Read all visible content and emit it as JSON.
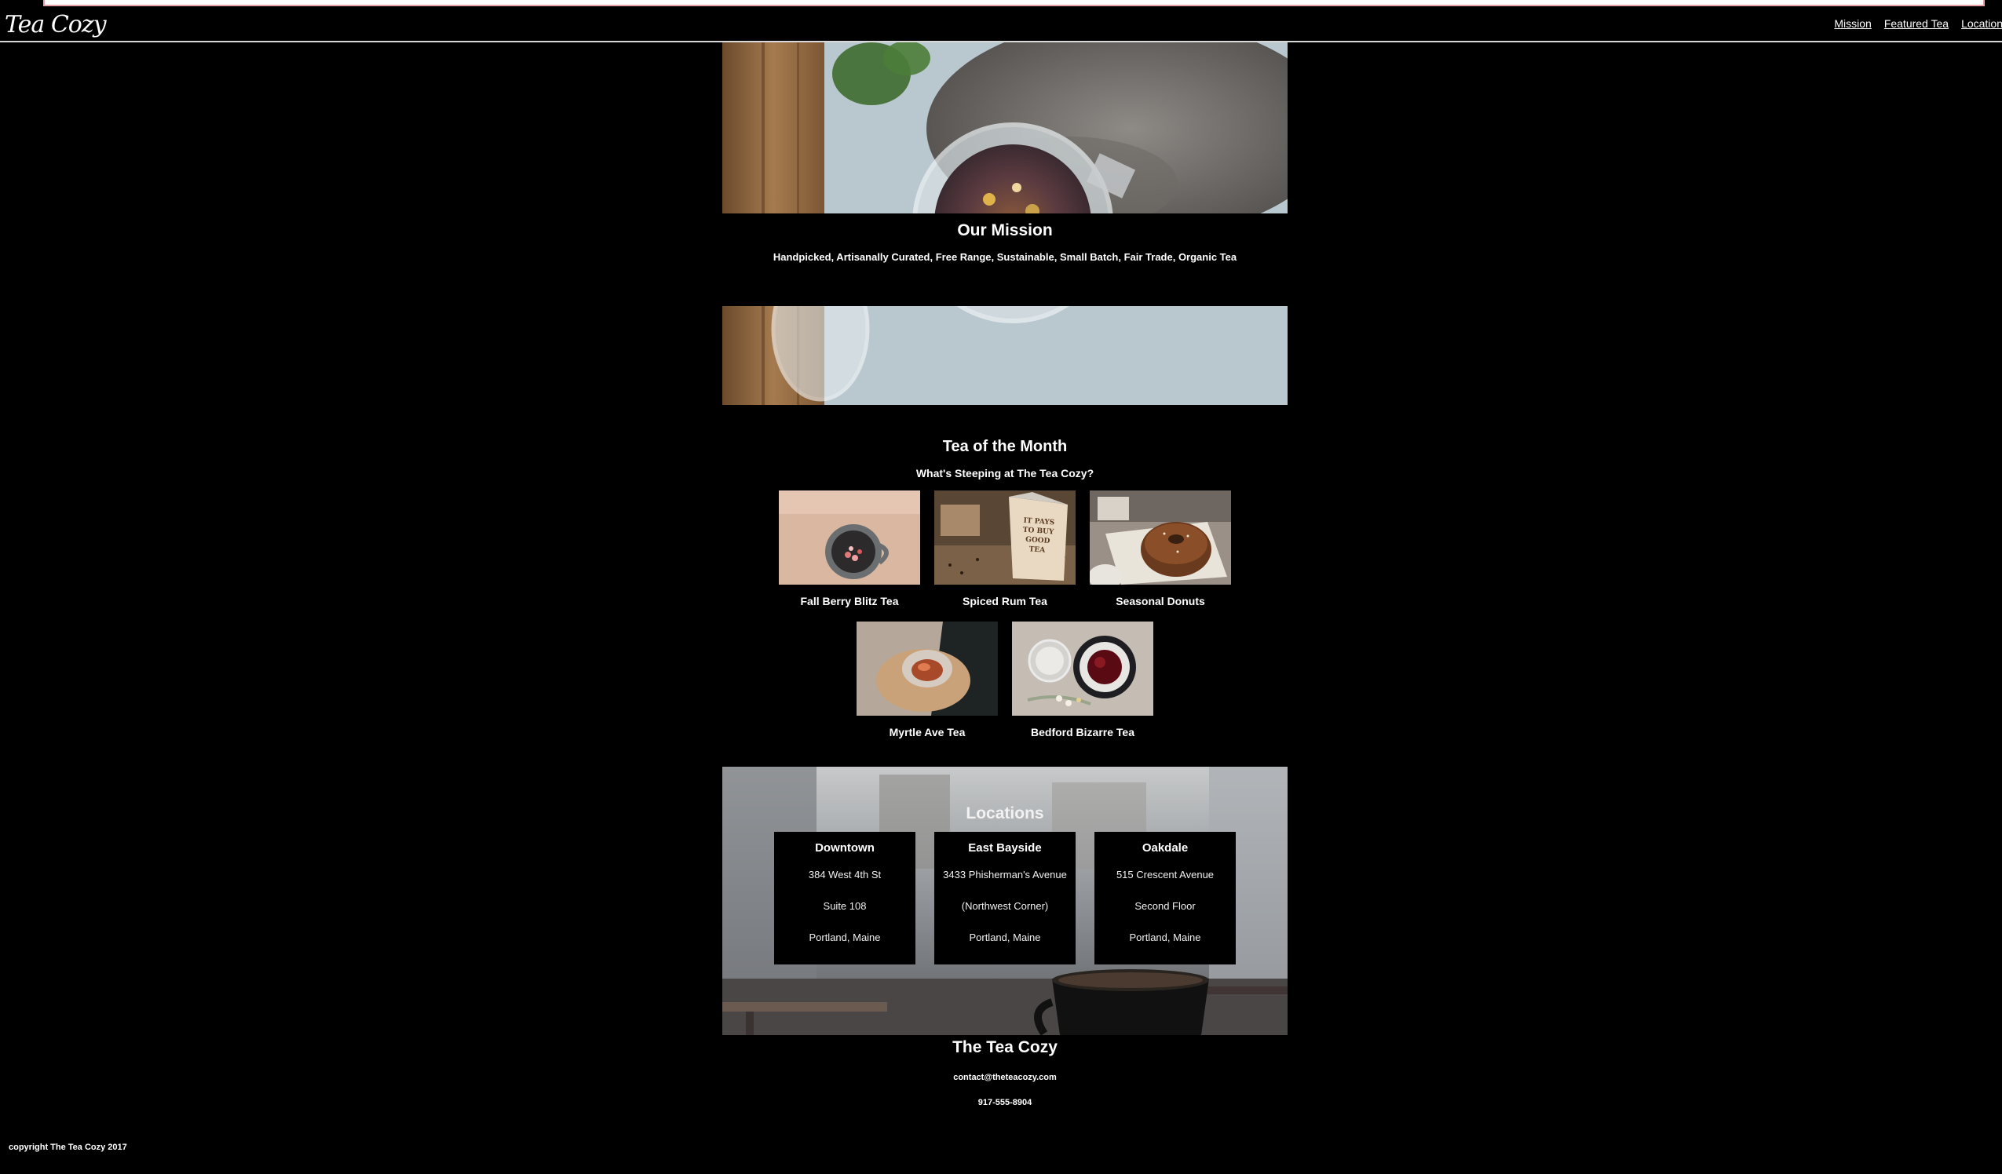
{
  "header": {
    "logo": "Tea Cozy",
    "nav": [
      {
        "label": "Mission"
      },
      {
        "label": "Featured Tea"
      },
      {
        "label": "Locations"
      }
    ]
  },
  "mission": {
    "title": "Our Mission",
    "tagline": "Handpicked, Artisanally Curated, Free Range, Sustainable, Small Batch, Fair Trade, Organic Tea"
  },
  "featured": {
    "title": "Tea of the Month",
    "subtitle": "What's Steeping at The Tea Cozy?",
    "items": [
      {
        "name": "Fall Berry Blitz Tea"
      },
      {
        "name": "Spiced Rum Tea"
      },
      {
        "name": "Seasonal Donuts"
      },
      {
        "name": "Myrtle Ave Tea"
      },
      {
        "name": "Bedford Bizarre Tea"
      }
    ],
    "box_text": "IT PAYS TO BUY GOOD TEA"
  },
  "locations": {
    "title": "Locations",
    "items": [
      {
        "name": "Downtown",
        "line1": "384 West 4th St",
        "line2": "Suite 108",
        "line3": "Portland, Maine"
      },
      {
        "name": "East Bayside",
        "line1": "3433 Phisherman's Avenue",
        "line2": "(Northwest Corner)",
        "line3": "Portland, Maine"
      },
      {
        "name": "Oakdale",
        "line1": "515 Crescent Avenue",
        "line2": "Second Floor",
        "line3": "Portland, Maine"
      }
    ]
  },
  "footer": {
    "title": "The Tea Cozy",
    "email": "contact@theteacozy.com",
    "phone": "917-555-8904",
    "copyright": "copyright The Tea Cozy 2017"
  }
}
